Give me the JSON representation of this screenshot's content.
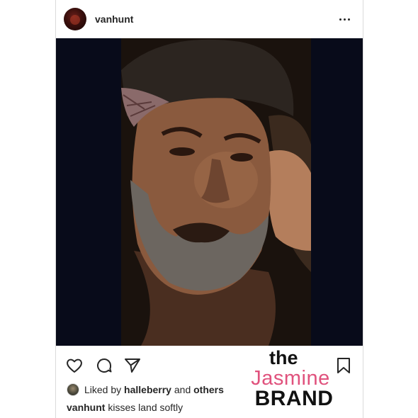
{
  "post": {
    "username": "vanhunt",
    "liked_by_prefix": "Liked by",
    "liked_by_user": "halleberry",
    "liked_by_and": "and",
    "liked_by_others": "others",
    "caption_user": "vanhunt",
    "caption_text": "kisses land softly"
  },
  "watermark": {
    "line1": "the",
    "line2": "Jasmine",
    "line3": "BRAND"
  },
  "icons": {
    "more": "more-icon",
    "like": "heart-icon",
    "comment": "comment-icon",
    "share": "paper-plane-icon",
    "save": "bookmark-icon"
  },
  "colors": {
    "text": "#262626",
    "border": "#dbdbdb",
    "watermark_pink": "#e0527d",
    "photo_background": "#080b1a"
  }
}
